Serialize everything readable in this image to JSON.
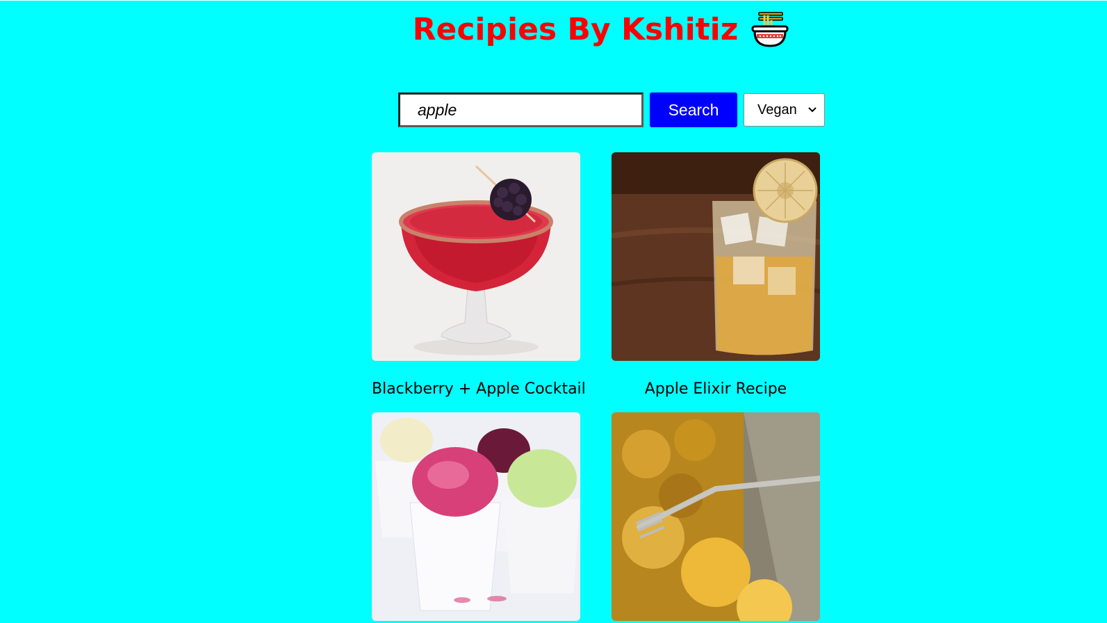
{
  "header": {
    "title": "Recipies By Kshitiz",
    "icon": "ramen-bowl-icon",
    "title_color": "#ff0000",
    "background_color": "#00ffff"
  },
  "search": {
    "value": "apple",
    "button_label": "Search",
    "button_color": "#0000ff",
    "filter_selected": "Vegan"
  },
  "recipes": [
    {
      "title": "Blackberry + Apple Cocktail",
      "image": "red-cocktail-with-blackberry"
    },
    {
      "title": "Apple Elixir Recipe",
      "image": "iced-apple-drink-with-dried-apple-chip"
    },
    {
      "title": "",
      "image": "colorful-granita-cups"
    },
    {
      "title": "",
      "image": "apple-granita-with-fork"
    }
  ]
}
